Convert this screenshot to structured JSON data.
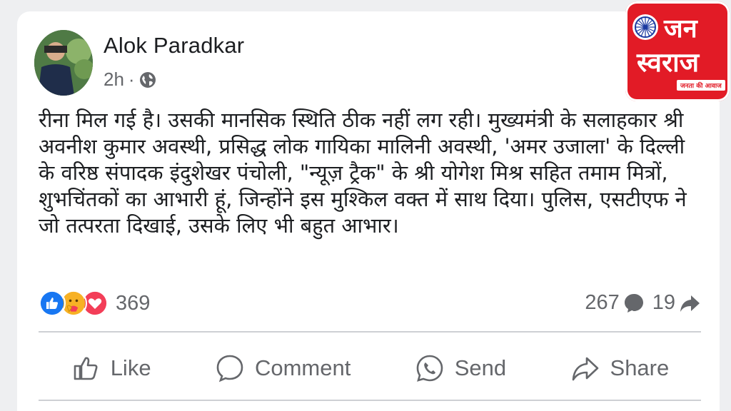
{
  "post": {
    "author": "Alok Paradkar",
    "time": "2h",
    "time_separator": "·",
    "visibility_icon": "globe-icon",
    "text": "रीना मिल गई है। उसकी मानसिक स्थिति ठीक नहीं लग रही। मुख्यमंत्री के सलाहकार श्री अवनीश कुमार अवस्थी, प्रसिद्ध लोक गायिका मालिनी अवस्थी, 'अमर उजाला' के दिल्ली के वरिष्ठ संपादक इंदुशेखर पंचोली, \"न्यूज़ ट्रैक\" के श्री योगेश मिश्र सहित तमाम मित्रों, शुभचिंतकों का आभारी हूं, जिन्होंने इस मुश्किल वक्त में साथ दिया। पुलिस, एसटीएफ ने जो तत्परता दिखाई, उसके लिए भी बहुत आभार।"
  },
  "reactions": {
    "icons": [
      "like-icon",
      "care-icon",
      "love-icon"
    ],
    "count": "369"
  },
  "stats": {
    "comments": "267",
    "shares": "19"
  },
  "actions": {
    "like": "Like",
    "comment": "Comment",
    "send": "Send",
    "share": "Share"
  },
  "logo": {
    "line1": "जन",
    "line2": "स्वराज",
    "tagline": "जनता की आवाज"
  },
  "colors": {
    "like_blue": "#1877f2",
    "love_red": "#f33e58",
    "care_yellow": "#f7b125",
    "logo_red": "#e21b26",
    "secondary_text": "#65676b"
  }
}
